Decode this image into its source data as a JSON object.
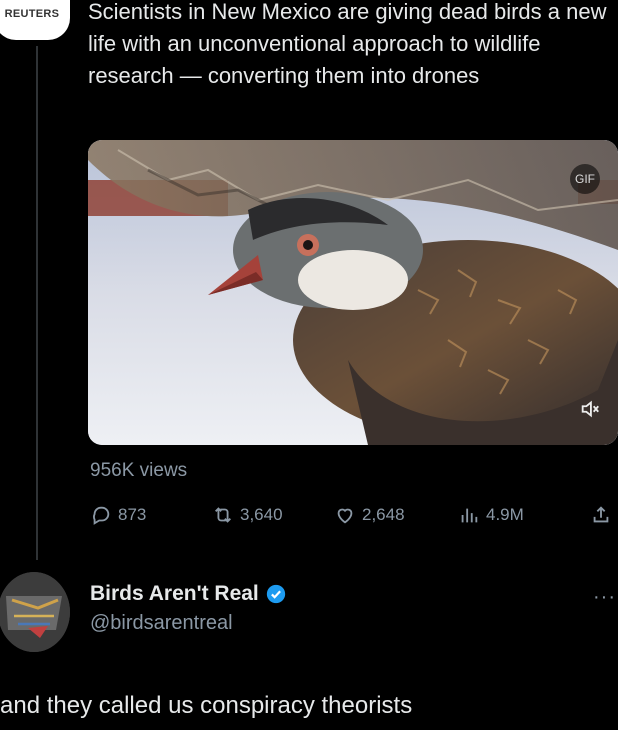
{
  "original_post": {
    "source_logo_text": "REUTERS",
    "text": "Scientists in New Mexico are giving dead birds a new life with an unconventional approach to wildlife research — converting them into drones",
    "views": "956K views",
    "stats": {
      "replies": "873",
      "reposts": "3,640",
      "likes": "2,648",
      "impressions": "4.9M"
    },
    "media_badge": "GIF"
  },
  "reply": {
    "avatar_text": "Birds Aren't Real",
    "author_name": "Birds Aren't Real",
    "handle": "@birdsarentreal",
    "more_label": "···",
    "text": "and they called us conspiracy theorists"
  },
  "colors": {
    "background": "#000000",
    "text_primary": "#e7e9ea",
    "text_secondary": "#8b98a5",
    "verified_blue": "#1d9bf0"
  }
}
